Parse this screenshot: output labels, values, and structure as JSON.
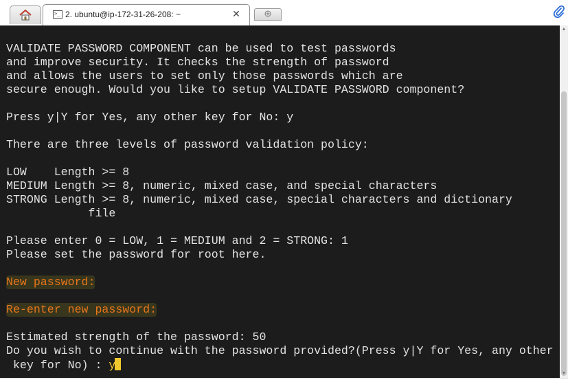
{
  "tabs": {
    "home_icon": "home-icon",
    "session_title": "2. ubuntu@ip-172-31-26-208: ~",
    "close_glyph": "✕",
    "new_tab_icon": "new-tab-plus-icon",
    "attach_icon": "paperclip-icon"
  },
  "terminal": {
    "lines": [
      "VALIDATE PASSWORD COMPONENT can be used to test passwords",
      "and improve security. It checks the strength of password",
      "and allows the users to set only those passwords which are",
      "secure enough. Would you like to setup VALIDATE PASSWORD component?",
      "",
      "Press y|Y for Yes, any other key for No: y",
      "",
      "There are three levels of password validation policy:",
      "",
      "LOW    Length >= 8",
      "MEDIUM Length >= 8, numeric, mixed case, and special characters",
      "STRONG Length >= 8, numeric, mixed case, special characters and dictionary",
      "            file",
      "",
      "Please enter 0 = LOW, 1 = MEDIUM and 2 = STRONG: 1",
      "Please set the password for root here.",
      "",
      "New password:",
      "",
      "Re-enter new password:",
      "",
      "Estimated strength of the password: 50",
      "Do you wish to continue with the password provided?(Press y|Y for Yes, any other",
      " key for No) : "
    ],
    "typed_input": "y",
    "colors": {
      "background": "#1c1c1c",
      "text": "#e3e3e3",
      "prompt_highlight": "#e8761a",
      "cursor": "#f0c82e"
    }
  }
}
